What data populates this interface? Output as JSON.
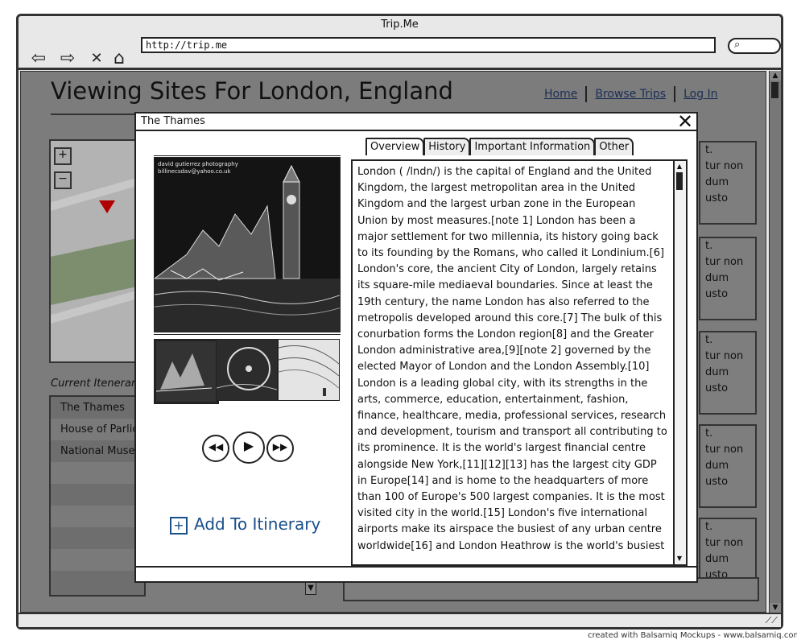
{
  "browser": {
    "title": "Trip.Me",
    "url": "http://trip.me",
    "nav_icons": [
      "back-arrow-icon",
      "forward-arrow-icon",
      "close-x-icon",
      "home-icon"
    ]
  },
  "page": {
    "heading": "Viewing Sites For London, England",
    "nav": {
      "home": "Home",
      "browse": "Browse Trips",
      "login": "Log In"
    },
    "map": {
      "zoom_in": "+",
      "zoom_out": "−"
    },
    "itinerary": {
      "label": "Current Itenerar",
      "items": [
        "The Thames",
        "House of Parlic",
        "National Museu"
      ]
    },
    "cards": [
      [
        "t.",
        "tur non",
        "dum",
        "usto"
      ],
      [
        "t.",
        "tur non",
        "dum",
        "usto"
      ],
      [
        "t.",
        "tur non",
        "dum",
        "usto"
      ],
      [
        "t.",
        "tur non",
        "dum",
        "usto"
      ],
      [
        "t.",
        "tur non",
        "dum",
        "usto"
      ]
    ]
  },
  "modal": {
    "title": "The Thames",
    "close": "X",
    "photo_caption_1": "david gutierrez photography",
    "photo_caption_2": "billinecsdav@yahoo.co.uk",
    "tabs": [
      "Overview",
      "History",
      "Important Information",
      "Other"
    ],
    "active_tab": "Overview",
    "add_label": "Add To Itinerary",
    "content_p1": "London ( /lndn/) is the capital of England and the United Kingdom, the largest metropolitan area in the United Kingdom and the largest urban zone in the European Union by most measures.[note 1] London has been a major settlement for two millennia, its history going back to its founding by the Romans, who called it Londinium.[6] London's core, the ancient City of London, largely retains its square-mile mediaeval boundaries. Since at least the 19th century, the name London has also referred to the metropolis developed around this core.[7] The bulk of this conurbation forms the London region[8] and the Greater London administrative area,[9][note 2] governed by the elected Mayor of London and the London Assembly.[10]",
    "content_p2": "London is a leading global city, with its strengths in the arts, commerce, education, entertainment, fashion, finance, healthcare, media, professional services, research and development, tourism and transport all contributing to its prominence. It is the world's largest financial centre alongside New York,[11][12][13] has the largest city GDP in Europe[14] and is home to the headquarters of more than 100 of Europe's 500 largest companies. It is the most visited city in the world.[15] London's five international airports make its airspace the busiest of any urban centre worldwide[16] and London Heathrow is the world's busiest"
  },
  "credit": "created with Balsamiq Mockups - www.balsamiq.com"
}
